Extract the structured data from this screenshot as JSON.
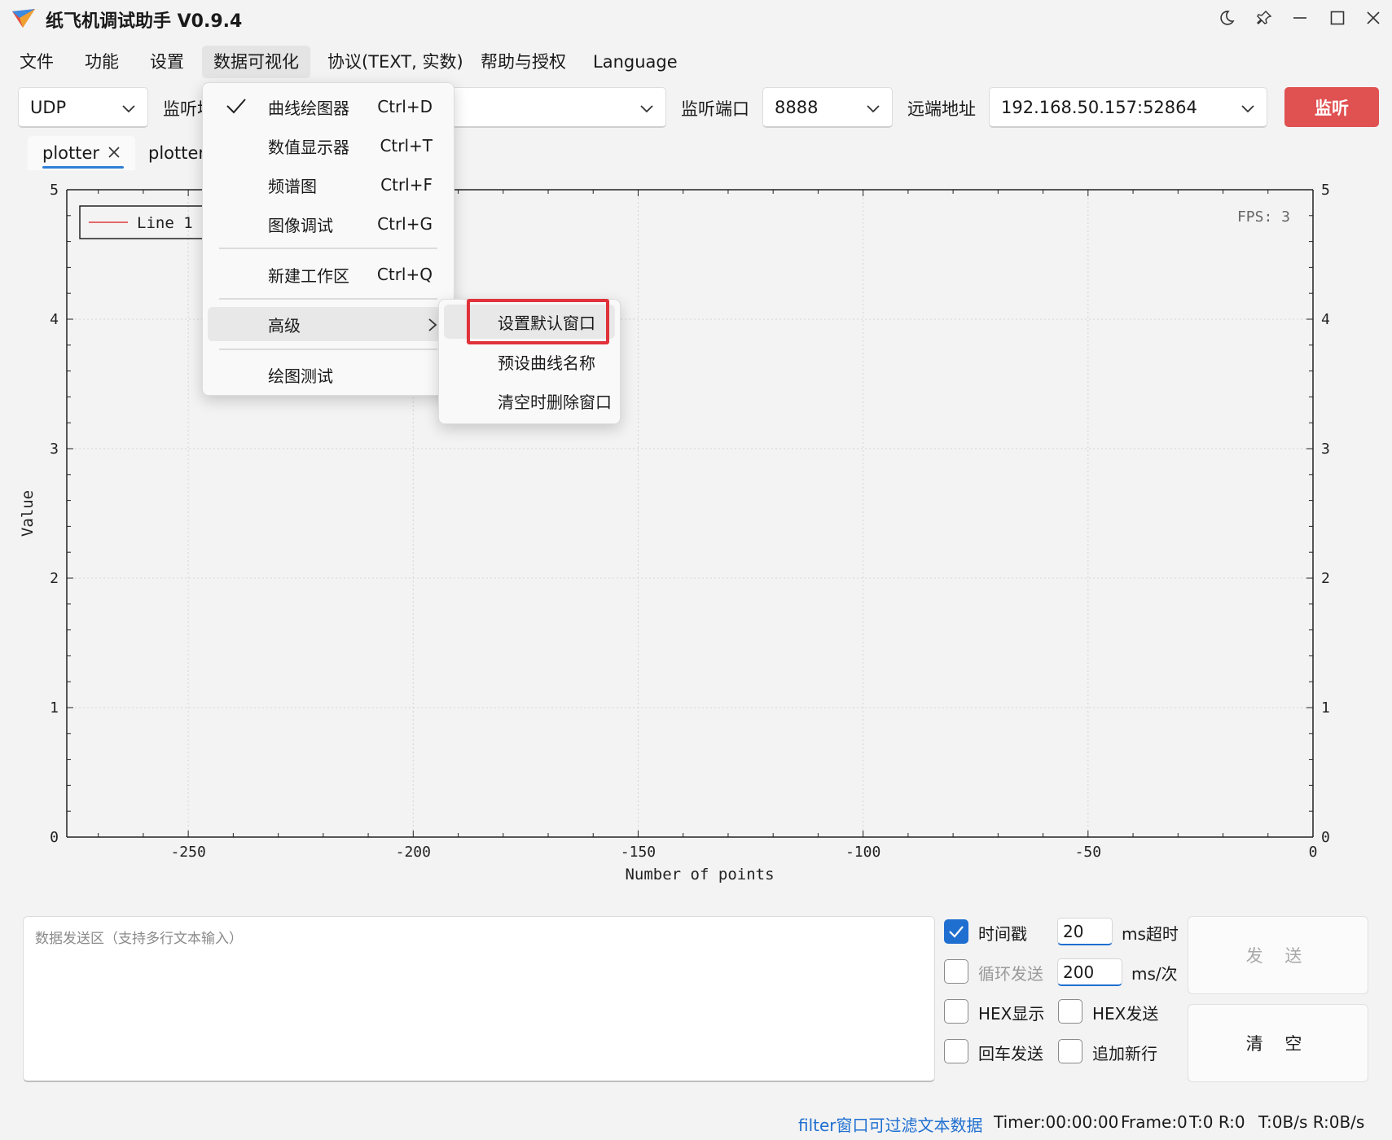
{
  "window": {
    "title": "纸飞机调试助手 V0.9.4",
    "controls": [
      "moon-icon",
      "pin-icon",
      "minimize-icon",
      "maximize-icon",
      "close-icon"
    ]
  },
  "menubar": {
    "items": [
      {
        "label": "文件"
      },
      {
        "label": "功能"
      },
      {
        "label": "设置"
      },
      {
        "label": "数据可视化",
        "active": true
      },
      {
        "label": "协议(TEXT, 实数)"
      },
      {
        "label": "帮助与授权"
      },
      {
        "label": "Language"
      }
    ]
  },
  "toolbar": {
    "protocol": "UDP",
    "listen_addr_label_partial": "监听地",
    "listen_port_label": "监听端口",
    "listen_port": "8888",
    "remote_addr_label": "远端地址",
    "remote_addr": "192.168.50.157:52864",
    "listen_button": "监听"
  },
  "tabs": [
    {
      "label": "plotter",
      "active": true
    },
    {
      "label": "plotter/"
    }
  ],
  "plot": {
    "legend": "Line 1",
    "fps": "FPS: 3"
  },
  "chart_data": {
    "type": "line",
    "title": "",
    "xlabel": "Number of points",
    "ylabel": "Value",
    "xlim": [
      -277,
      0
    ],
    "ylim": [
      0,
      5
    ],
    "x_ticks": [
      -250,
      -200,
      -150,
      -100,
      -50,
      0
    ],
    "y_ticks": [
      0,
      1,
      2,
      3,
      4,
      5
    ],
    "grid": true,
    "legend_position": "top-left",
    "series": [
      {
        "name": "Line 1",
        "color": "#e03c3c",
        "x": [],
        "y": []
      }
    ]
  },
  "dropdown": {
    "items": [
      {
        "label": "曲线绘图器",
        "shortcut": "Ctrl+D",
        "checked": true
      },
      {
        "label": "数值显示器",
        "shortcut": "Ctrl+T"
      },
      {
        "label": "频谱图",
        "shortcut": "Ctrl+F"
      },
      {
        "label": "图像调试",
        "shortcut": "Ctrl+G"
      },
      {
        "label": "新建工作区",
        "shortcut": "Ctrl+Q"
      },
      {
        "label": "高级",
        "has_submenu": true
      },
      {
        "label": "绘图测试"
      }
    ]
  },
  "submenu": {
    "items": [
      {
        "label": "设置默认窗口",
        "highlighted": true
      },
      {
        "label": "预设曲线名称"
      },
      {
        "label": "清空时删除窗口"
      }
    ]
  },
  "send": {
    "placeholder": "数据发送区（支持多行文本输入）",
    "timestamp_label": "时间戳",
    "timestamp_checked": true,
    "timeout_value": "20",
    "timeout_unit": "ms超时",
    "loop_label": "循环发送",
    "loop_value": "200",
    "loop_unit": "ms/次",
    "hex_display_label": "HEX显示",
    "hex_send_label": "HEX发送",
    "enter_send_label": "回车发送",
    "append_newline_label": "追加新行",
    "send_button": "发 送",
    "clear_button": "清 空"
  },
  "status": {
    "filter_hint": "filter窗口可过滤文本数据",
    "timer": "Timer:00:00:00",
    "frame": "Frame:0",
    "tr": "T:0 R:0",
    "rates": "T:0B/s R:0B/s"
  },
  "colors": {
    "accent": "#1f6fd0",
    "listen_button": "#e05151",
    "highlight_box": "#e0323a",
    "line1": "#e03c3c"
  }
}
